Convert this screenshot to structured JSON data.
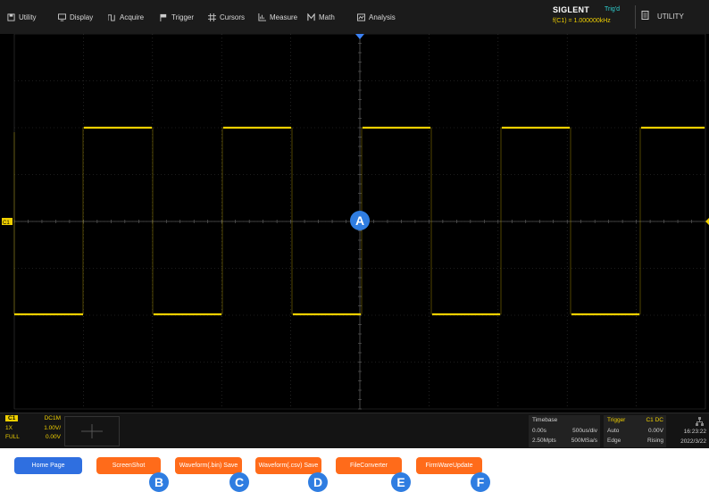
{
  "menu": [
    {
      "label": "Utility",
      "icon": "save-icon"
    },
    {
      "label": "Display",
      "icon": "monitor-icon"
    },
    {
      "label": "Acquire",
      "icon": "acquire-icon"
    },
    {
      "label": "Trigger",
      "icon": "flag-icon"
    },
    {
      "label": "Cursors",
      "icon": "cursors-icon"
    },
    {
      "label": "Measure",
      "icon": "measure-icon"
    },
    {
      "label": "Math",
      "icon": "math-icon"
    },
    {
      "label": "Analysis",
      "icon": "analysis-icon"
    }
  ],
  "header": {
    "brand": "SIGLENT",
    "trig_status": "Trig'd",
    "frequency": "f(C1) = 1.000000kHz",
    "utility_label": "UTILITY"
  },
  "channel": {
    "name": "C1",
    "coupling": "DC1M",
    "probe": "1X",
    "scale": "1.00V/",
    "bandwidth": "FULL",
    "offset": "0.00V",
    "marker": "C1"
  },
  "timebase": {
    "title": "Timebase",
    "delay": "0.00s",
    "scale": "500us/div",
    "memory": "2.50Mpts",
    "sample_rate": "500MSa/s"
  },
  "trigger": {
    "title": "Trigger",
    "source": "C1 DC",
    "mode": "Auto",
    "level": "0.00V",
    "type": "Edge",
    "slope": "Rising"
  },
  "clock": {
    "time": "16:23:22",
    "date": "2022/3/22"
  },
  "buttons": [
    {
      "label": "Home Page",
      "color": "#2f6fe0"
    },
    {
      "label": "ScreenShot",
      "color": "#ff6b1a"
    },
    {
      "label": "Waveform(.bin) Save",
      "color": "#ff6b1a"
    },
    {
      "label": "Waveform(.csv) Save",
      "color": "#ff6b1a"
    },
    {
      "label": "FileConverter",
      "color": "#ff6b1a"
    },
    {
      "label": "FirmWareUpdate",
      "color": "#ff6b1a"
    }
  ],
  "callouts": [
    "A",
    "B",
    "C",
    "D",
    "E",
    "F"
  ],
  "colors": {
    "trace": "#f0d000",
    "grid": "#3a3a3a",
    "marker": "#3b82f6"
  }
}
